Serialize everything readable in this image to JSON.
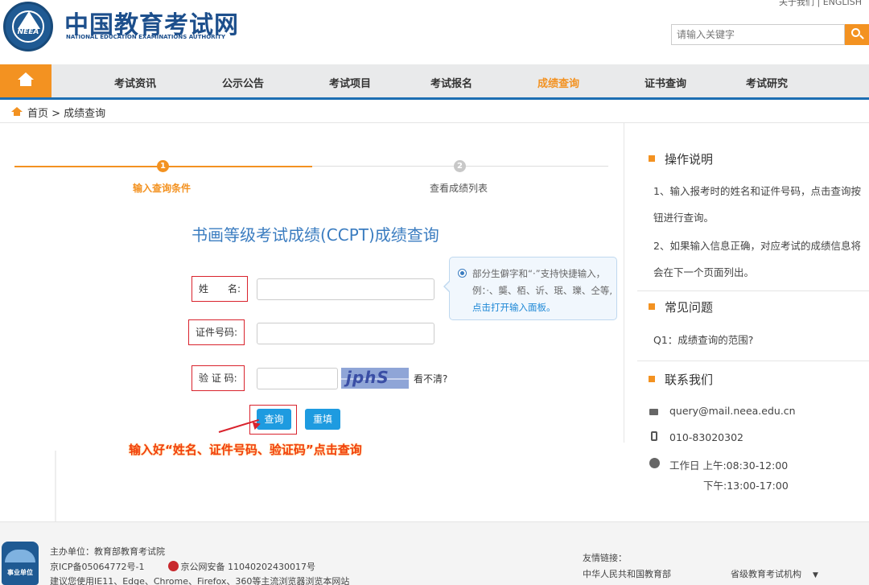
{
  "header": {
    "logo_text": "NEEA",
    "title": "中国教育考试网",
    "subtitle": "NATIONAL EDUCATION EXAMINATIONS AUTHORITY",
    "top_links": "关于我们 | ENGLISH",
    "search_placeholder": "请输入关键字"
  },
  "nav": {
    "items": [
      "考试资讯",
      "公示公告",
      "考试项目",
      "考试报名",
      "成绩查询",
      "证书查询",
      "考试研究"
    ],
    "active_index": 4
  },
  "breadcrumb": "首页 > 成绩查询",
  "steps": [
    {
      "num": "1",
      "label": "输入查询条件"
    },
    {
      "num": "2",
      "label": "查看成绩列表"
    }
  ],
  "form": {
    "title": "书画等级考试成绩(CCPT)成绩查询",
    "name_label": "姓　　名:",
    "id_label": "证件号码:",
    "captcha_label": "验 证 码:",
    "captcha_text": "jphS",
    "captcha_refresh": "看不清?",
    "query_button": "查询",
    "reset_button": "重填"
  },
  "tip": {
    "text": "部分生僻字和“·”支持快捷输入，例：·、龑、栢、䜣、珉、瓅、仝等,",
    "link": "点击打开输入面板。"
  },
  "annotation": "输入好“姓名、证件号码、验证码”点击查询",
  "sidebar": {
    "ops_title": "操作说明",
    "ops_1": "1、输入报考时的姓名和证件号码，点击查询按钮进行查询。",
    "ops_2": "2、如果输入信息正确，对应考试的成绩信息将会在下一个页面列出。",
    "faq_title": "常见问题",
    "faq_1": "Q1：成绩查询的范围?",
    "contact_title": "联系我们",
    "email": "query@mail.neea.edu.cn",
    "phone": "010-83020302",
    "hours_1": "工作日 上午:08:30-12:00",
    "hours_2": "下午:13:00-17:00"
  },
  "footer": {
    "badge": "事业单位",
    "host": "主办单位：教育部教育考试院",
    "icp": "京ICP备05064772号-1",
    "police": "京公网安备 11040202430017号",
    "browser": "建议您使用IE11、Edge、Chrome、Firefox、360等主流浏览器浏览本网站",
    "links_label": "友情链接：",
    "link_1": "中华人民共和国教育部",
    "link_2": "省级教育考试机构",
    "link_2_arrow": "▼"
  },
  "colors": {
    "accent": "#f39221",
    "brand": "#1d4f8c",
    "link": "#1e88d6",
    "button": "#1e9be0",
    "highlight": "#d9232d"
  }
}
